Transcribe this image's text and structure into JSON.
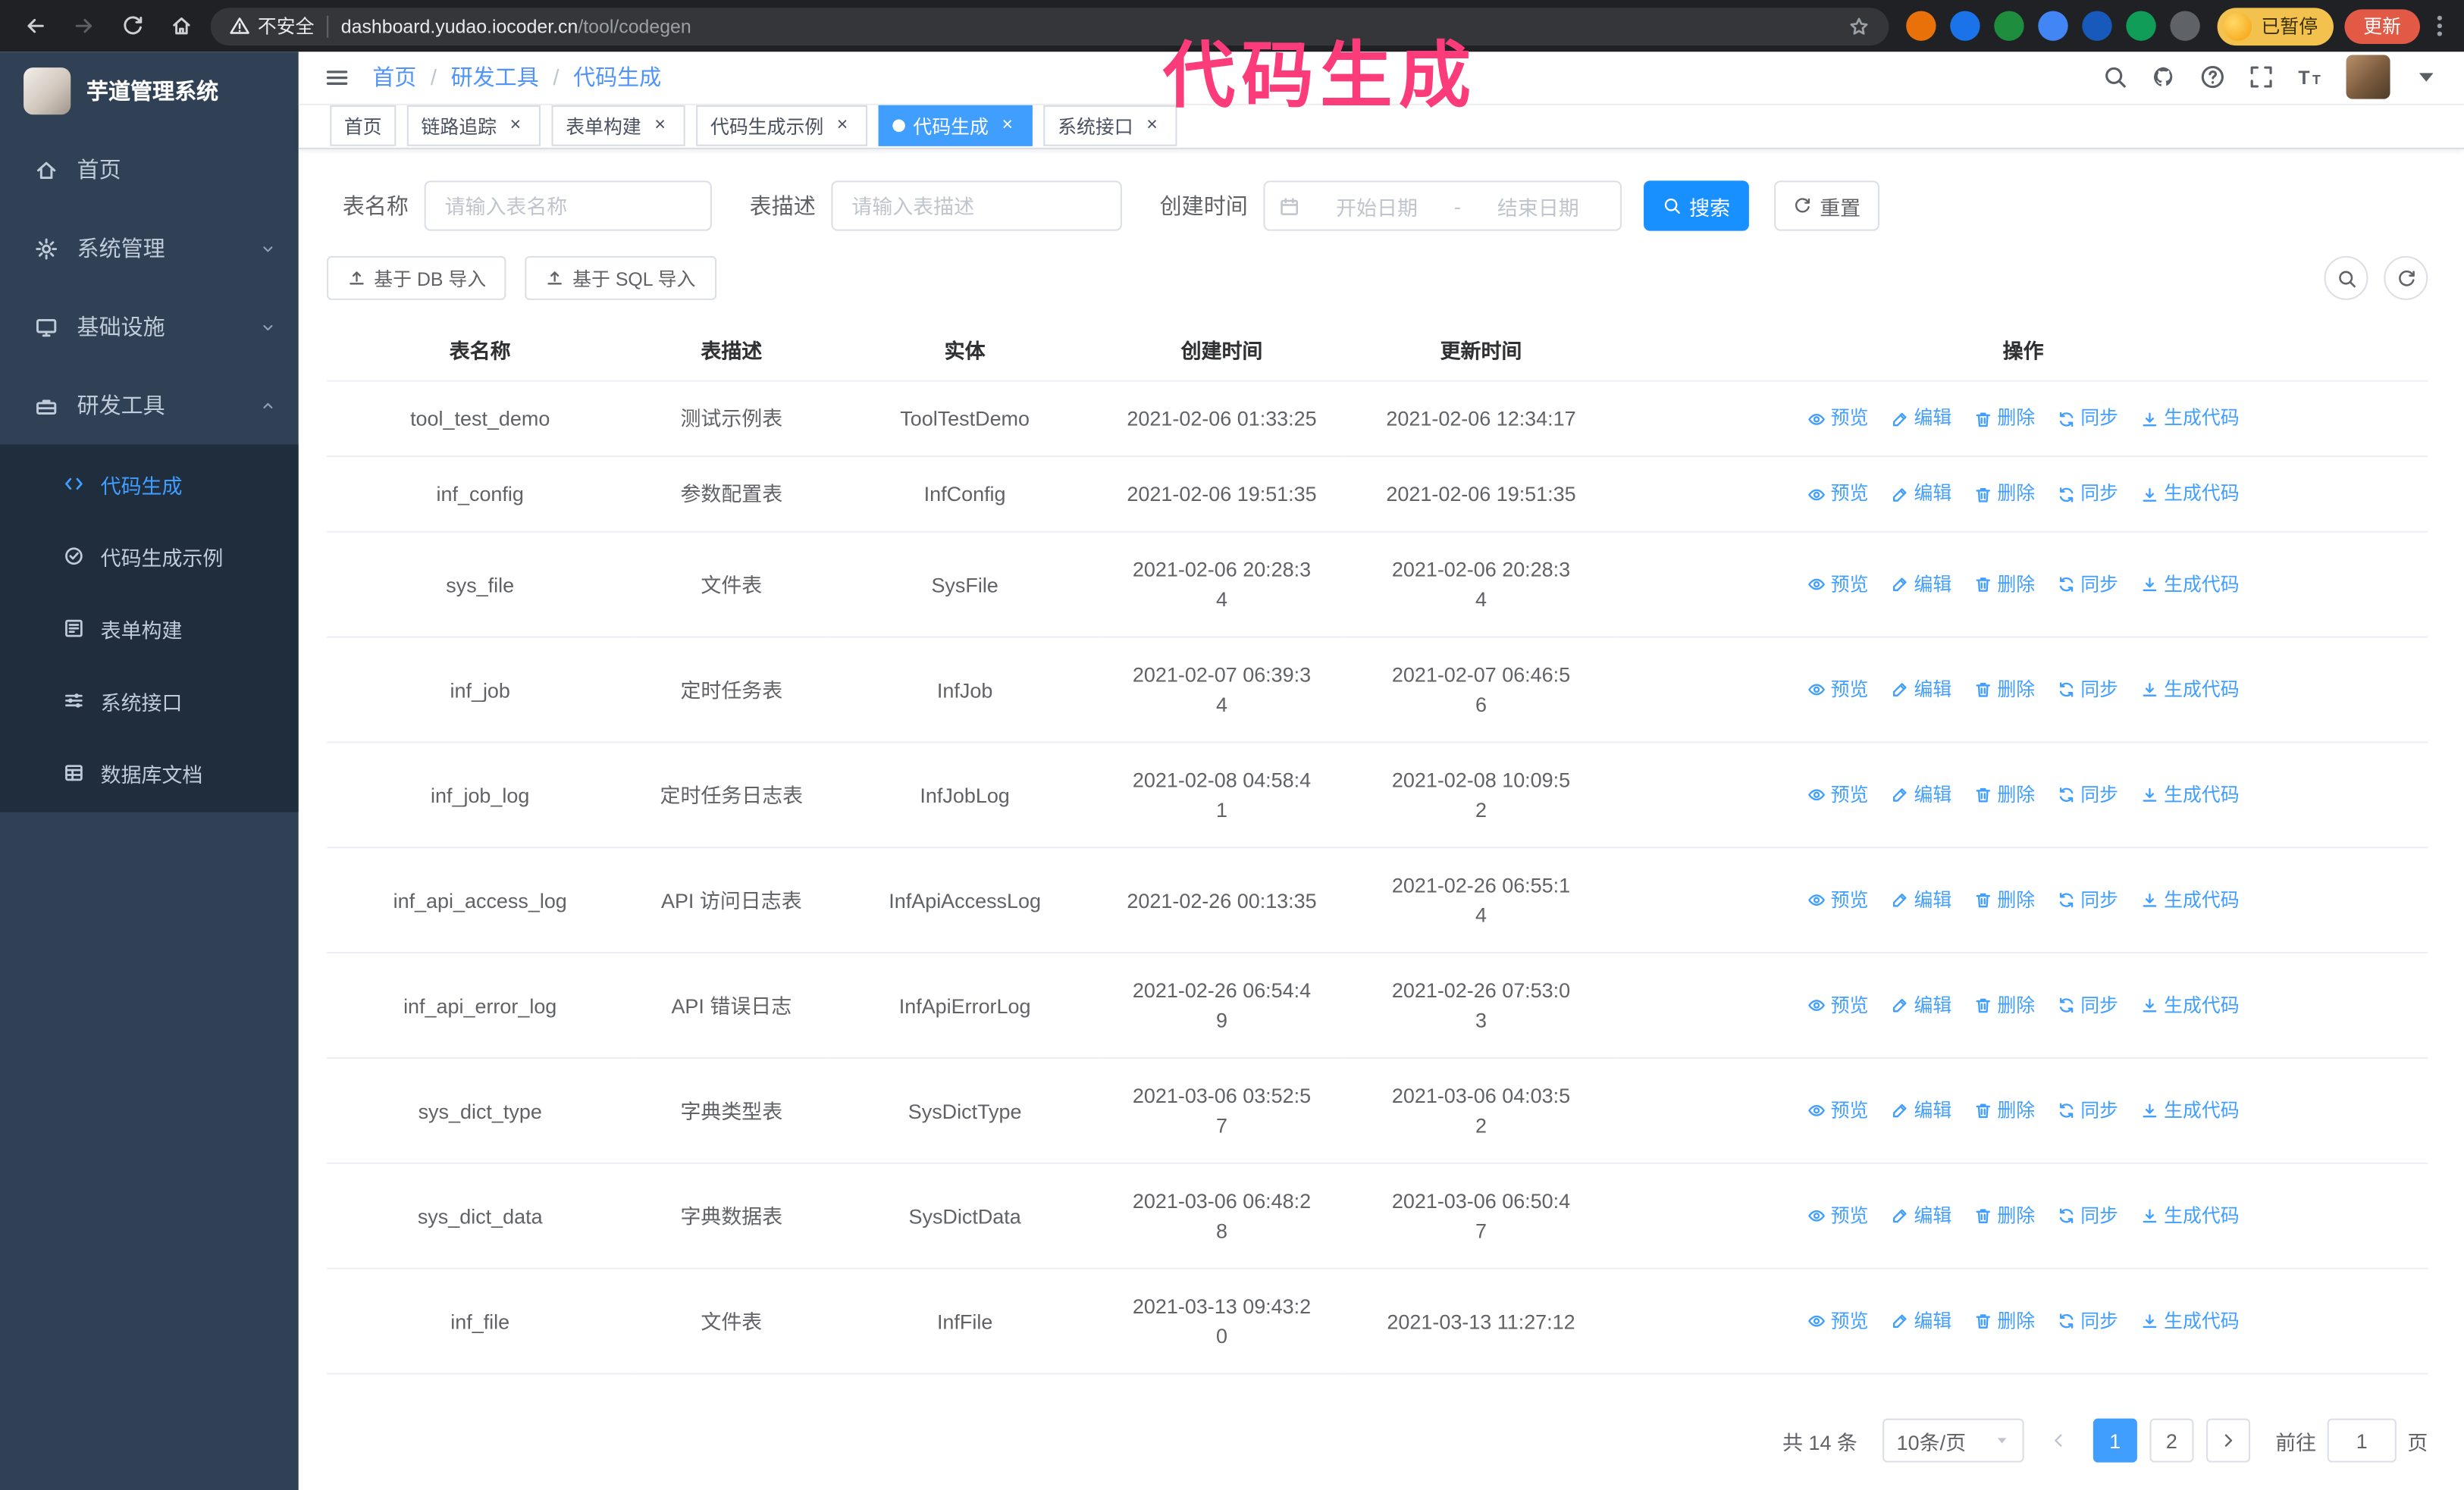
{
  "annotation": {
    "text": "代码生成"
  },
  "browser": {
    "security_label": "不安全",
    "url_host": "dashboard.yudao.iocoder.cn",
    "url_path": "/tool/codegen",
    "paused_badge": "已暂停",
    "update_button": "更新"
  },
  "sidebar": {
    "logo_title": "芋道管理系统",
    "items": [
      {
        "label": "首页"
      },
      {
        "label": "系统管理"
      },
      {
        "label": "基础设施"
      },
      {
        "label": "研发工具"
      }
    ],
    "submenu": [
      {
        "label": "代码生成"
      },
      {
        "label": "代码生成示例"
      },
      {
        "label": "表单构建"
      },
      {
        "label": "系统接口"
      },
      {
        "label": "数据库文档"
      }
    ]
  },
  "header": {
    "breadcrumb": [
      "首页",
      "研发工具",
      "代码生成"
    ],
    "breadcrumb_separator": "/"
  },
  "tabs": [
    {
      "label": "首页"
    },
    {
      "label": "链路追踪"
    },
    {
      "label": "表单构建"
    },
    {
      "label": "代码生成示例"
    },
    {
      "label": "代码生成"
    },
    {
      "label": "系统接口"
    }
  ],
  "filters": {
    "table_name_label": "表名称",
    "table_name_placeholder": "请输入表名称",
    "table_desc_label": "表描述",
    "table_desc_placeholder": "请输入表描述",
    "create_time_label": "创建时间",
    "date_start_placeholder": "开始日期",
    "date_separator": "-",
    "date_end_placeholder": "结束日期",
    "search_button": "搜索",
    "reset_button": "重置"
  },
  "toolbar": {
    "import_db_button": "基于 DB 导入",
    "import_sql_button": "基于 SQL 导入"
  },
  "table": {
    "columns": [
      "表名称",
      "表描述",
      "实体",
      "创建时间",
      "更新时间",
      "操作"
    ],
    "action_labels": [
      "预览",
      "编辑",
      "删除",
      "同步",
      "生成代码"
    ],
    "rows": [
      {
        "name": "tool_test_demo",
        "desc": "测试示例表",
        "entity": "ToolTestDemo",
        "created": "2021-02-06 01:33:25",
        "updated": "2021-02-06 12:34:17"
      },
      {
        "name": "inf_config",
        "desc": "参数配置表",
        "entity": "InfConfig",
        "created": "2021-02-06 19:51:35",
        "updated": "2021-02-06 19:51:35"
      },
      {
        "name": "sys_file",
        "desc": "文件表",
        "entity": "SysFile",
        "created": "2021-02-06 20:28:3\n4",
        "updated": "2021-02-06 20:28:3\n4"
      },
      {
        "name": "inf_job",
        "desc": "定时任务表",
        "entity": "InfJob",
        "created": "2021-02-07 06:39:3\n4",
        "updated": "2021-02-07 06:46:5\n6"
      },
      {
        "name": "inf_job_log",
        "desc": "定时任务日志表",
        "entity": "InfJobLog",
        "created": "2021-02-08 04:58:4\n1",
        "updated": "2021-02-08 10:09:5\n2"
      },
      {
        "name": "inf_api_access_log",
        "desc": "API 访问日志表",
        "entity": "InfApiAccessLog",
        "created": "2021-02-26 00:13:35",
        "updated": "2021-02-26 06:55:1\n4"
      },
      {
        "name": "inf_api_error_log",
        "desc": "API 错误日志",
        "entity": "InfApiErrorLog",
        "created": "2021-02-26 06:54:4\n9",
        "updated": "2021-02-26 07:53:0\n3"
      },
      {
        "name": "sys_dict_type",
        "desc": "字典类型表",
        "entity": "SysDictType",
        "created": "2021-03-06 03:52:5\n7",
        "updated": "2021-03-06 04:03:5\n2"
      },
      {
        "name": "sys_dict_data",
        "desc": "字典数据表",
        "entity": "SysDictData",
        "created": "2021-03-06 06:48:2\n8",
        "updated": "2021-03-06 06:50:4\n7"
      },
      {
        "name": "inf_file",
        "desc": "文件表",
        "entity": "InfFile",
        "created": "2021-03-13 09:43:2\n0",
        "updated": "2021-03-13 11:27:12"
      }
    ]
  },
  "pagination": {
    "total": "共 14 条",
    "page_size": "10条/页",
    "pages": [
      "1",
      "2"
    ],
    "active_page": "1",
    "goto_label": "前往",
    "goto_value": "1",
    "goto_suffix": "页"
  },
  "icons": {
    "row_actions": [
      "eye",
      "edit",
      "trash",
      "sync",
      "download"
    ],
    "header_right": [
      "search",
      "github",
      "question",
      "fullscreen",
      "font-size"
    ],
    "colors": {
      "accent": "#409eff",
      "annotation": "#fb3b7a",
      "sidebar_bg": "#304156",
      "submenu_bg": "#1f2d3d"
    }
  }
}
